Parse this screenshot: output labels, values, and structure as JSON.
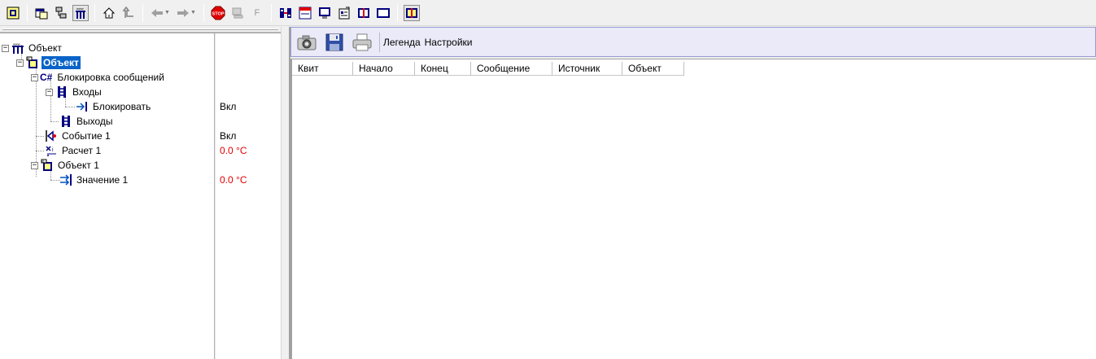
{
  "toolbar": {
    "icons": [
      "open-object-icon",
      "window-icon",
      "network-icon",
      "object-tree-icon",
      "home-icon",
      "up-level-icon",
      "back-arrow-icon",
      "forward-arrow-icon",
      "stop-icon",
      "computer-icon",
      "font-icon",
      "connection-icon",
      "calendar-icon",
      "monitor-icon",
      "properties-icon",
      "book-icon",
      "rectangle-window-icon",
      "journal-icon"
    ],
    "stop_label": "STOP",
    "f_label": "F"
  },
  "tree": {
    "root": "Объект",
    "selected": "Объект",
    "items": [
      {
        "label": "Блокировка сообщений",
        "prefix": "C#"
      },
      {
        "label": "Входы"
      },
      {
        "label": "Блокировать",
        "value": "Вкл"
      },
      {
        "label": "Выходы"
      },
      {
        "label": "Событие 1",
        "value": "Вкл"
      },
      {
        "label": "Расчет 1",
        "value": "0.0 °C"
      },
      {
        "label": "Объект 1"
      },
      {
        "label": "Значение 1",
        "value": "0.0 °C"
      }
    ]
  },
  "right_toolbar": {
    "legend": "Легенда",
    "settings": "Настройки"
  },
  "grid": {
    "columns": [
      "Квит",
      "Начало",
      "Конец",
      "Сообщение",
      "Источник",
      "Объект"
    ]
  },
  "colors": {
    "selection": "#0a64c8",
    "value_red": "#e00000",
    "toolbar_accent": "#eaeaf8"
  }
}
